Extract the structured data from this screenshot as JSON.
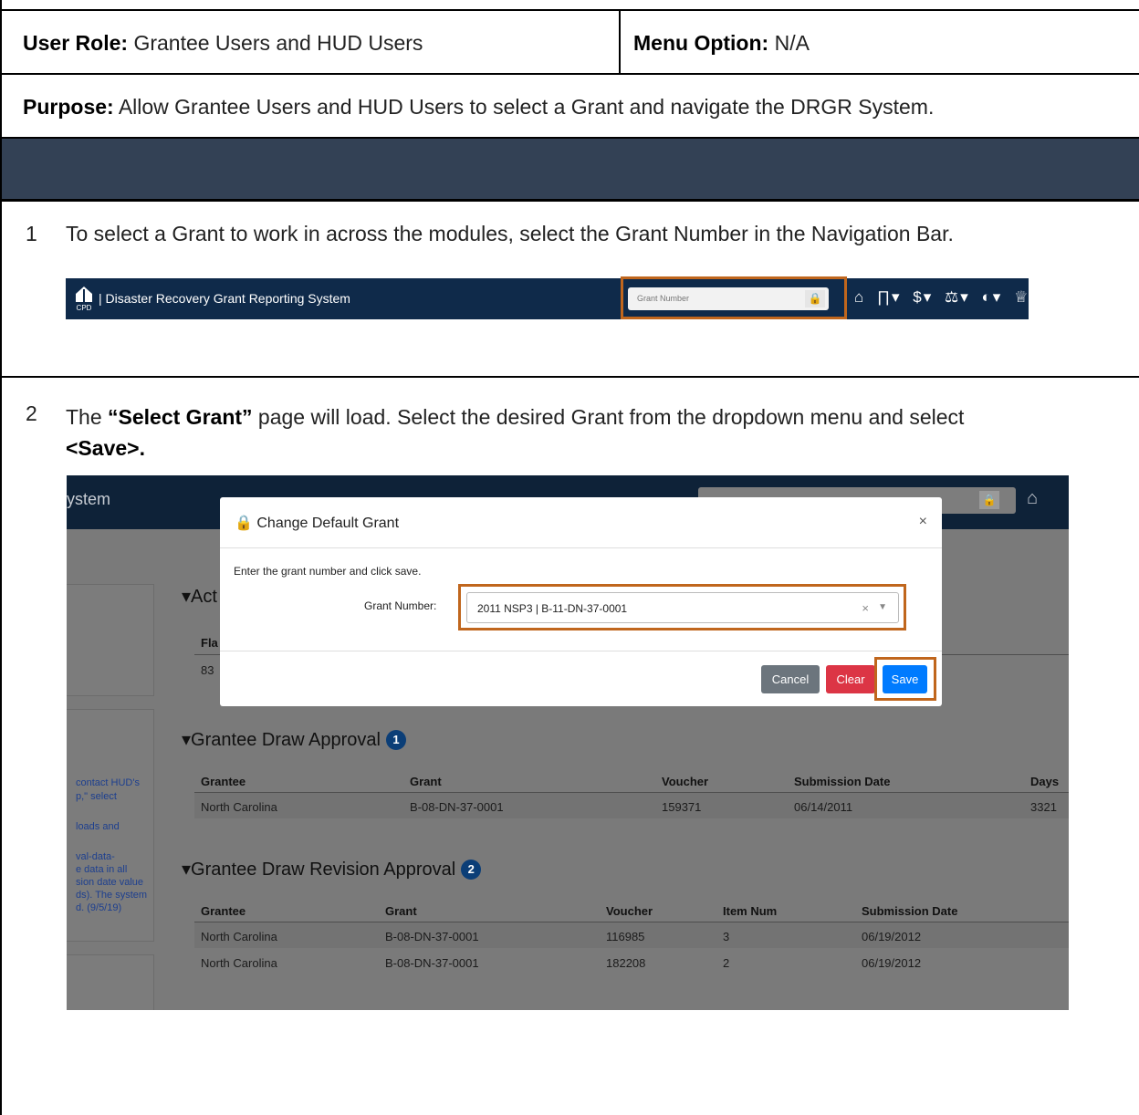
{
  "header": {
    "role_label": "User Role:",
    "role_value": "Grantee Users and HUD Users",
    "menu_label": "Menu Option:",
    "menu_value": "N/A"
  },
  "purpose": {
    "label": "Purpose:",
    "text": "Allow Grantee Users and HUD Users to select a Grant and navigate the DRGR System."
  },
  "step1": {
    "number": "1",
    "text": "To select a Grant to work in across the modules, select the Grant Number in the Navigation Bar.",
    "navbar": {
      "logo_text": "CPD",
      "title": "Disaster Recovery Grant Reporting System",
      "grant_placeholder": "Grant Number"
    }
  },
  "step2": {
    "number": "2",
    "text_pre": "The ",
    "page_name": "“Select Grant”",
    "text_post": " page will load. Select the desired Grant from the dropdown menu and select",
    "save_ref": "<Save>."
  },
  "screenshot": {
    "system_text": "ystem",
    "modal": {
      "title": "Change Default Grant",
      "close": "×",
      "hint": "Enter the grant number and click save.",
      "field_label": "Grant Number:",
      "field_value": "2011 NSP3 | B-11-DN-37-0001",
      "buttons": {
        "cancel": "Cancel",
        "clear": "Clear",
        "save": "Save"
      }
    },
    "partial_section": "Act",
    "partial_header": "Fla",
    "partial_cell": "83",
    "draw_approval": {
      "title": "Grantee Draw Approval",
      "badge": "1",
      "headers": [
        "Grantee",
        "Grant",
        "Voucher",
        "Submission Date",
        "Days"
      ],
      "rows": [
        [
          "North Carolina",
          "B-08-DN-37-0001",
          "159371",
          "06/14/2011",
          "3321"
        ]
      ]
    },
    "draw_revision": {
      "title": "Grantee Draw Revision Approval",
      "badge": "2",
      "headers": [
        "Grantee",
        "Grant",
        "Voucher",
        "Item Num",
        "Submission Date"
      ],
      "rows": [
        [
          "North Carolina",
          "B-08-DN-37-0001",
          "116985",
          "3",
          "06/19/2012"
        ],
        [
          "North Carolina",
          "B-08-DN-37-0001",
          "182208",
          "2",
          "06/19/2012"
        ]
      ]
    },
    "side_links": [
      "contact HUD's",
      "p,\" select",
      "loads and",
      "val-data-",
      "e data in all",
      "sion date value",
      "ds). The system",
      "d. (9/5/19)"
    ]
  },
  "colors": {
    "band": "#334155",
    "navbar": "#0f2a4a",
    "highlight": "#c0661d",
    "badge": "#0b3e77"
  }
}
